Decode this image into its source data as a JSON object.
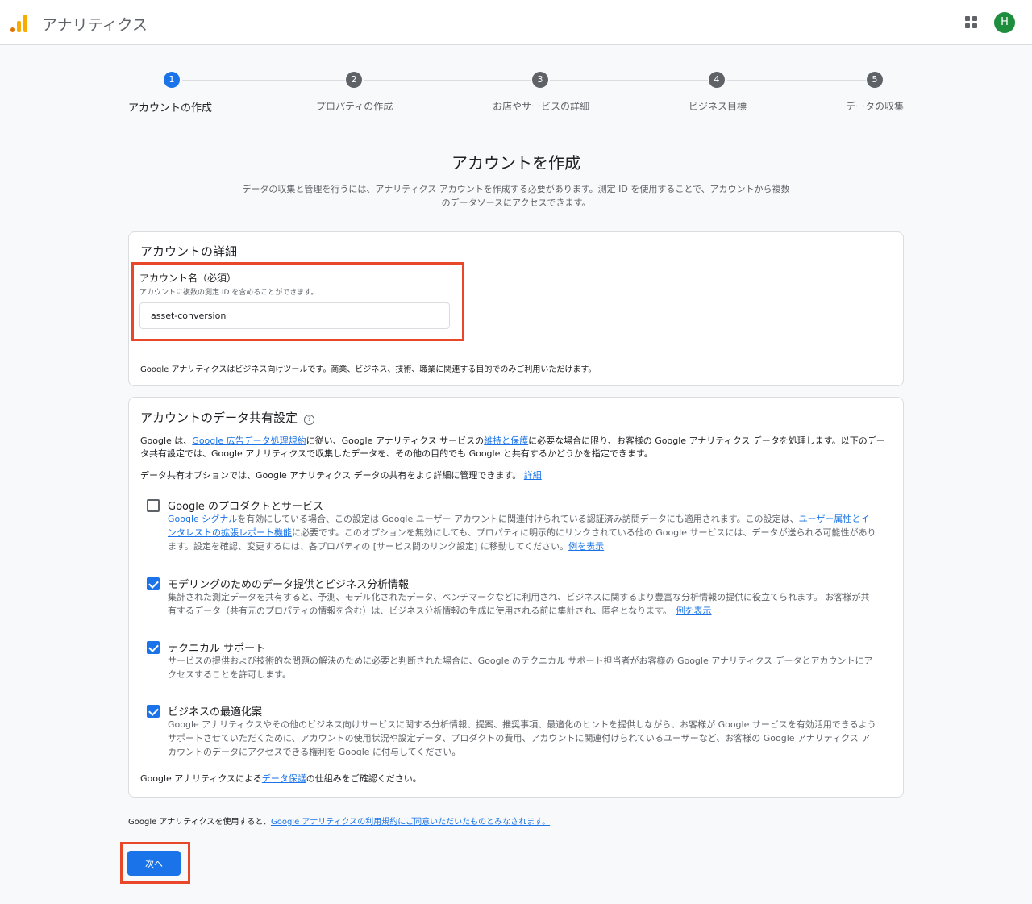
{
  "header": {
    "app_title": "アナリティクス",
    "avatar_initial": "H",
    "icons": [
      "analytics-logo-icon",
      "apps-grid-icon"
    ]
  },
  "stepper": {
    "current_step": 1,
    "steps": [
      {
        "number": "1",
        "label": "アカウントの作成"
      },
      {
        "number": "2",
        "label": "プロパティの作成"
      },
      {
        "number": "3",
        "label": "お店やサービスの詳細"
      },
      {
        "number": "4",
        "label": "ビジネス目標"
      },
      {
        "number": "5",
        "label": "データの収集"
      }
    ]
  },
  "page": {
    "title": "アカウントを作成",
    "description": "データの収集と管理を行うには、アナリティクス アカウントを作成する必要があります。測定 ID を使用することで、アカウントから複数のデータソースにアクセスできます。"
  },
  "account_details": {
    "title": "アカウントの詳細",
    "field_label": "アカウント名（必須）",
    "field_hint": "アカウントに複数の測定 ID を含めることができます。",
    "field_value": "asset-conversion",
    "notice": "Google アナリティクスはビジネス向けツールです。商業、ビジネス、技術、職業に関連する目的でのみご利用いただけます。"
  },
  "data_sharing": {
    "title": "アカウントのデータ共有設定",
    "help_icon": "?",
    "intro_a": "Google は、",
    "intro_link1": "Google 広告データ処理規約",
    "intro_b": "に従い、Google アナリティクス サービスの",
    "intro_link2": "維持と保護",
    "intro_c": "に必要な場合に限り、お客様の Google アナリティクス データを処理します。以下のデータ共有設定では、Google アナリティクスで収集したデータを、その他の目的でも Google と共有するかどうかを指定できます。",
    "options_note": "データ共有オプションでは、Google アナリティクス データの共有をより詳細に管理できます。",
    "options_note_link": "詳細",
    "options": [
      {
        "title": "Google のプロダクトとサービス",
        "checked": false,
        "desc_link1": "Google シグナル",
        "desc_a": "を有効にしている場合、この設定は Google ユーザー アカウントに関連付けられている認証済み訪問データにも適用されます。この設定は、",
        "desc_link2": "ユーザー属性とインタレストの拡張レポート機能",
        "desc_b": "に必要です。このオプションを無効にしても、プロパティに明示的にリンクされている他の Google サービスには、データが送られる可能性があります。設定を確認、変更するには、各プロパティの [サービス間のリンク設定] に移動してください。",
        "desc_link3": "例を表示"
      },
      {
        "title": "モデリングのためのデータ提供とビジネス分析情報",
        "checked": true,
        "desc": "集計された測定データを共有すると、予測、モデル化されたデータ、ベンチマークなどに利用され、ビジネスに関するより豊富な分析情報の提供に役立てられます。 お客様が共有するデータ（共有元のプロパティの情報を含む）は、ビジネス分析情報の生成に使用される前に集計され、匿名となります。",
        "desc_link": "例を表示"
      },
      {
        "title": "テクニカル サポート",
        "checked": true,
        "desc": "サービスの提供および技術的な問題の解決のために必要と判断された場合に、Google のテクニカル サポート担当者がお客様の Google アナリティクス データとアカウントにアクセスすることを許可します。"
      },
      {
        "title": "ビジネスの最適化案",
        "checked": true,
        "desc": "Google アナリティクスやその他のビジネス向けサービスに関する分析情報、提案、推奨事項、最適化のヒントを提供しながら、お客様が Google サービスを有効活用できるようサポートさせていただくために、アカウントの使用状況や設定データ、プロダクトの費用、アカウントに関連付けられているユーザーなど、お客様の Google アナリティクス アカウントのデータにアクセスできる権利を Google に付与してください。"
      }
    ],
    "footer_a": "Google アナリティクスによる",
    "footer_link": "データ保護",
    "footer_b": "の仕組みをご確認ください。"
  },
  "terms": {
    "text": "Google アナリティクスを使用すると、",
    "link": "Google アナリティクスの利用規約にご同意いただいたものとみなされます。"
  },
  "next_button": "次へ",
  "colors": {
    "accent": "#1a73e8",
    "highlight": "#e8472a",
    "avatar": "#1e8e3e"
  }
}
